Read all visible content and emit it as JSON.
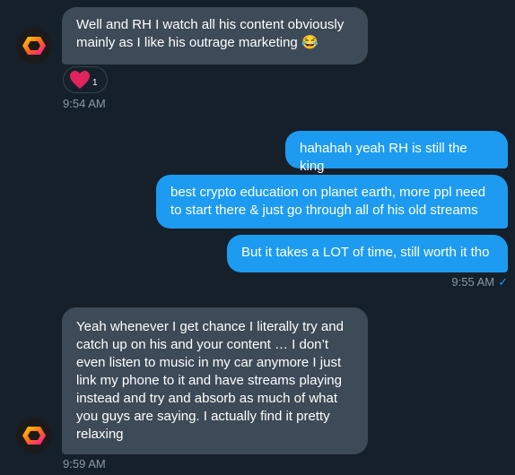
{
  "messages": [
    {
      "direction": "incoming",
      "text": "Well and RH I watch all his content obviously mainly as I like his outrage marketing 😂",
      "reaction": {
        "emoji": "heart",
        "count": "1"
      },
      "time": "9:54 AM"
    },
    {
      "direction": "outgoing",
      "text": "hahahah yeah RH is still the king"
    },
    {
      "direction": "outgoing",
      "text": "best crypto education on planet earth, more ppl need to start there & just go through all of his old streams"
    },
    {
      "direction": "outgoing",
      "text": "But it takes a LOT of time, still worth it tho",
      "time": "9:55 AM",
      "status": "sent"
    },
    {
      "direction": "incoming",
      "text": "Yeah whenever I get chance I literally try and catch up on his and your content … I don’t even listen to music in my car anymore I just link my phone to it and have streams playing instead and try and absorb as much of what you guys are saying. I actually find it pretty relaxing",
      "time": "9:59 AM"
    }
  ],
  "colors": {
    "background": "#15202b",
    "incoming_bubble": "#3d4a57",
    "outgoing_bubble": "#1d9bf0",
    "timestamp": "#8b98a5"
  },
  "icons": [
    "hex-logo-avatar-icon",
    "heart-reaction-icon",
    "checkmark-icon"
  ]
}
